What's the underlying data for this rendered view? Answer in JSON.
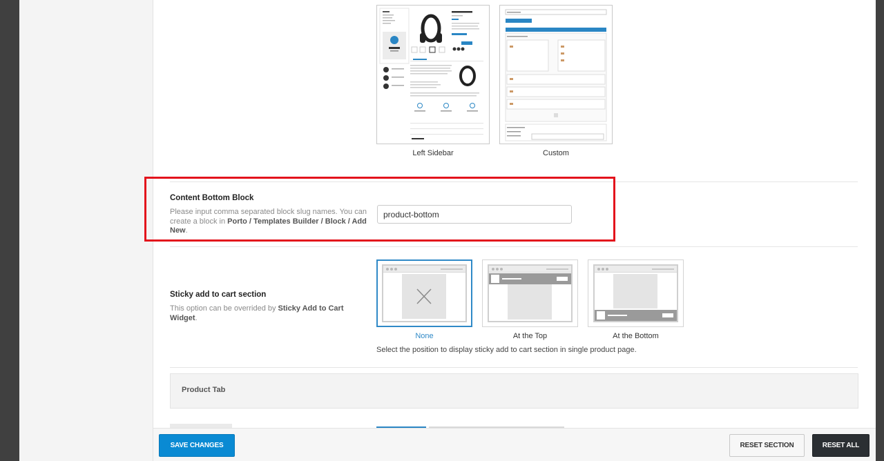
{
  "layouts": [
    {
      "caption": "Left Sidebar",
      "thumb_icon": "left-sidebar-layout-preview-icon"
    },
    {
      "caption": "Custom",
      "thumb_icon": "custom-layout-preview-icon"
    }
  ],
  "content_bottom_block": {
    "title": "Content Bottom Block",
    "desc_1": "Please input comma separated block slug names. You can create a block in ",
    "desc_bold": "Porto / Templates Builder / Block / Add New",
    "desc_2": ".",
    "value": "product-bottom"
  },
  "sticky_cart": {
    "title": "Sticky add to cart section",
    "desc_1": "This option can be overrided by ",
    "desc_bold": "Sticky Add to Cart Widget",
    "desc_2": ".",
    "options": [
      {
        "label": "None",
        "icon": "close-icon",
        "selected": true
      },
      {
        "label": "At the Top",
        "icon": "top-bar-layout-icon",
        "selected": false
      },
      {
        "label": "At the Bottom",
        "icon": "bottom-bar-layout-icon",
        "selected": false
      }
    ],
    "help": "Select the position to display sticky add to cart section in single product page."
  },
  "product_tab": {
    "title": "Product Tab"
  },
  "footer": {
    "save_label": "SAVE CHANGES",
    "reset_section_label": "RESET SECTION",
    "reset_all_label": "RESET ALL"
  },
  "colors": {
    "accent": "#0a8ad3",
    "highlight": "#e3131c",
    "dark_button": "#2b2f33"
  }
}
